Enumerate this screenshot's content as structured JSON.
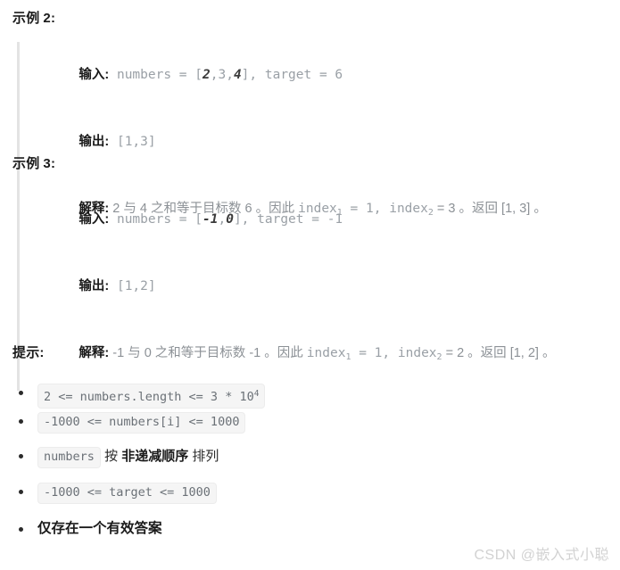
{
  "examples": [
    {
      "heading": "示例 2:",
      "heading_text": "示例",
      "heading_num": "2:",
      "input_label": "输入:",
      "input_prefix": " numbers = [",
      "input_a": "2",
      "input_mid": ",3,",
      "input_b": "4",
      "input_suffix": "], target = 6",
      "output_label": "输出:",
      "output_value": " [1,3]",
      "explain_label": "解释:",
      "explain_part1": " 2 与 4 之和等于目标数 6 。因此 ",
      "explain_index1": "index",
      "explain_sub1": "1",
      "explain_eq1": " = 1, ",
      "explain_index2": "index",
      "explain_sub2": "2",
      "explain_eq2": " = 3 。返回 [1, 3] 。"
    },
    {
      "heading": "示例 3:",
      "heading_text": "示例",
      "heading_num": "3:",
      "input_label": "输入:",
      "input_prefix": " numbers = [",
      "input_a": "-1",
      "input_mid": ",",
      "input_b": "0",
      "input_suffix": "], target = -1",
      "output_label": "输出:",
      "output_value": " [1,2]",
      "explain_label": "解释:",
      "explain_part1": " -1 与 0 之和等于目标数 -1 。因此 ",
      "explain_index1": "index",
      "explain_sub1": "1",
      "explain_eq1": " = 1, ",
      "explain_index2": "index",
      "explain_sub2": "2",
      "explain_eq2": " = 2 。返回 [1, 2] 。"
    }
  ],
  "hints": {
    "heading": "提示:",
    "items": [
      {
        "kind": "code-exp",
        "code_before": "2 <= numbers.length <= 3 * 10",
        "code_sup": "4"
      },
      {
        "kind": "code",
        "code": "-1000 <= numbers[i] <= 1000"
      },
      {
        "kind": "code-text",
        "code": "numbers",
        "text_before": " 按 ",
        "text_bold": "非递减顺序",
        "text_after": " 排列"
      },
      {
        "kind": "code",
        "code": "-1000 <= target <= 1000"
      },
      {
        "kind": "bold-text",
        "text": "仅存在一个有效答案"
      }
    ]
  },
  "watermark": {
    "text": "CSDN @嵌入式小聪"
  },
  "colors": {
    "background": "#ffffff",
    "body_text": "#333333",
    "code_text": "#9aa0a6",
    "heading_text": "#1a1a1a",
    "blockquote_border": "#e3e3e3",
    "chip_background": "#f5f5f5",
    "watermark": "#d2d2d2"
  }
}
